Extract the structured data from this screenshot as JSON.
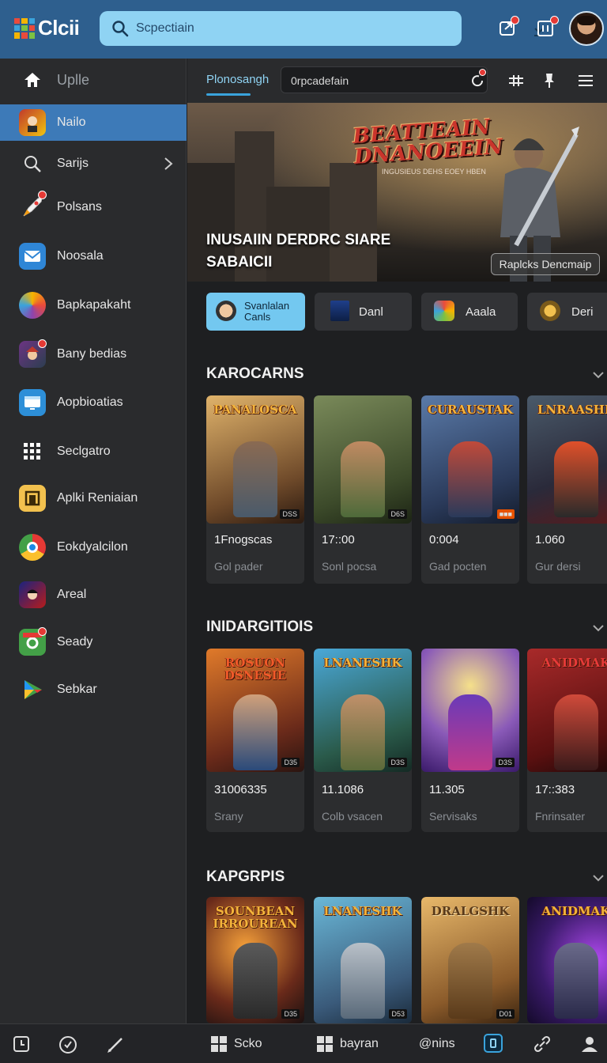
{
  "app": {
    "logo_text": "Clcii"
  },
  "search": {
    "placeholder": "Scpectiain"
  },
  "colors": {
    "topbar": "#2e5f8e",
    "search_bg": "#8fd3f3",
    "active": "#3d7ab8",
    "accent": "#73c8f0",
    "background": "#1e1f21"
  },
  "sidebar": {
    "items": [
      {
        "label": "Uplle",
        "icon": "home-icon"
      },
      {
        "label": "Nailo",
        "icon": "game-character-icon"
      },
      {
        "label": "Sarijs",
        "icon": "search-icon"
      },
      {
        "label": "Polsans",
        "icon": "rocket-icon"
      },
      {
        "label": "Noosala",
        "icon": "mail-icon"
      },
      {
        "label": "Bapkapakaht",
        "icon": "feather-icon"
      },
      {
        "label": "Bany bedias",
        "icon": "jester-icon"
      },
      {
        "label": "Aopbioatias",
        "icon": "window-icon"
      },
      {
        "label": "Seclgatro",
        "icon": "grid-dots-icon"
      },
      {
        "label": "Aplki Reniaian",
        "icon": "gate-icon"
      },
      {
        "label": "Eokdyalcilon",
        "icon": "chrome-icon"
      },
      {
        "label": "Areal",
        "icon": "anime-character-icon"
      },
      {
        "label": "Seady",
        "icon": "camera-icon"
      },
      {
        "label": "Sebkar",
        "icon": "play-triangle-icon"
      }
    ]
  },
  "subbar": {
    "active_tab": "Plonosangh",
    "input_placeholder": "0rpcadefain"
  },
  "hero": {
    "title_art": "BEATTEAIN DNANOEEIN",
    "title_sub": "INGUSIEUS DEHS EOEY HBEN",
    "caption": "INUSAIIN DERDRC SIARE SABAICII",
    "button": "Raplcks Dencmaip"
  },
  "chips": [
    {
      "label": "Svanlalan Canls",
      "icon": "avatar-icon"
    },
    {
      "label": "Danl",
      "icon": "book-icon"
    },
    {
      "label": "Aaala",
      "icon": "emoji-icon"
    },
    {
      "label": "Deri",
      "icon": "crest-icon"
    }
  ],
  "sections": [
    {
      "title": "KAROCARNS",
      "cards": [
        {
          "art_title": "PANALOSCA",
          "tag": "DSS",
          "number": "1Fnogscas",
          "sub": "Gol pader"
        },
        {
          "art_title": "",
          "tag": "D6S",
          "number": "17::00",
          "sub": "Sonl pocsa"
        },
        {
          "art_title": "CURAUSTAK",
          "tag": "",
          "number": "0:004",
          "sub": "Gad pocten"
        },
        {
          "art_title": "LNRAASHK",
          "tag": "",
          "number": "1.060",
          "sub": "Gur dersi"
        }
      ]
    },
    {
      "title": "INIDARGITIOIS",
      "cards": [
        {
          "art_title": "ROSUON DSNESIE",
          "tag": "D35",
          "number": "31006335",
          "sub": "Srany"
        },
        {
          "art_title": "LNANESHK",
          "tag": "D3S",
          "number": "11.1086",
          "sub": "Colb vsacen"
        },
        {
          "art_title": "",
          "tag": "D3S",
          "number": "11.305",
          "sub": "Servisaks"
        },
        {
          "art_title": "ANIDMAK",
          "tag": "",
          "number": "17::383",
          "sub": "Fnrinsater"
        }
      ]
    },
    {
      "title": "KAPGRPIS",
      "cards": [
        {
          "art_title": "SOUNBEAN IRROUREAN",
          "tag": "D35",
          "number": "",
          "sub": ""
        },
        {
          "art_title": "LNANESHK",
          "tag": "D53",
          "number": "",
          "sub": ""
        },
        {
          "art_title": "DRALGSHK",
          "tag": "D01",
          "number": "",
          "sub": ""
        },
        {
          "art_title": "ANIDMAK",
          "tag": "",
          "number": "",
          "sub": ""
        }
      ]
    }
  ],
  "bottombar": {
    "items": [
      {
        "label": "Scko",
        "icon": "grid-icon"
      },
      {
        "label": "bayran",
        "icon": "grid-icon"
      },
      {
        "label": "@nins",
        "icon": ""
      }
    ]
  }
}
